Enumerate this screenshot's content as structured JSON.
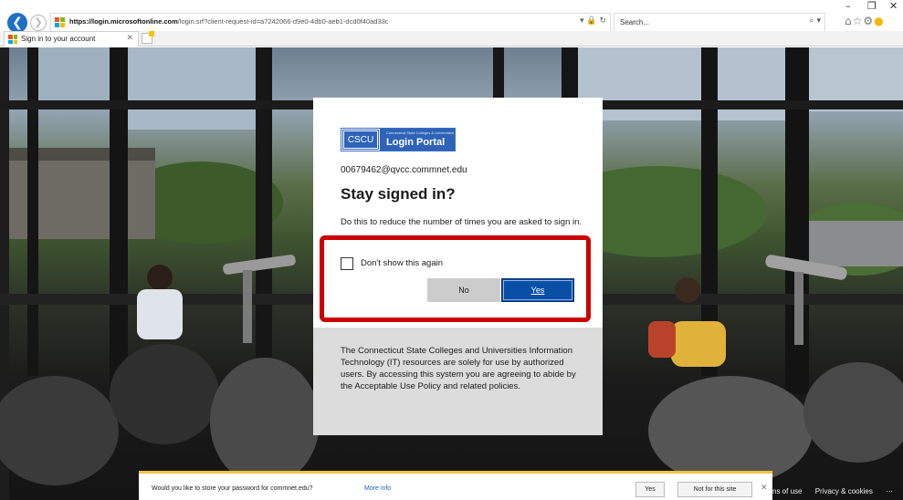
{
  "browser": {
    "url_host": "https://login.microsoftonline.com",
    "url_path": "/login.srf?client-request-id=a7242066-d9e0-4db0-aeb1-dcd0f40ad33c",
    "search_placeholder": "Search...",
    "tab_title": "Sign in to your account",
    "window_controls": {
      "minimize": "–",
      "maximize": "❐",
      "close": "✕"
    }
  },
  "dialog": {
    "logo_cscu": "CSCU",
    "logo_small": "Connecticut State Colleges & Universities",
    "logo_portal": "Login Portal",
    "email": "00679462@qvcc.commnet.edu",
    "heading": "Stay signed in?",
    "description": "Do this to reduce the number of times you are asked to sign in.",
    "checkbox_label": "Don't show this again",
    "no_label": "No",
    "yes_label": "Yes",
    "footer_text": "The Connecticut State Colleges and Universities Information Technology (IT) resources are solely for use by authorized users. By accessing this system you are agreeing to abide by the Acceptable Use Policy and related policies."
  },
  "notification": {
    "message": "Would you like to store your password for commnet.edu?",
    "more_info": "More info",
    "yes_label": "Yes",
    "not_label": "Not for this site",
    "close": "✕"
  },
  "page_footer": {
    "terms": "ns of use",
    "privacy": "Privacy & cookies",
    "more": "···"
  },
  "colors": {
    "accent_blue": "#0a4fa6",
    "highlight_red": "#cc0000",
    "notification_border": "#f0c33c"
  }
}
